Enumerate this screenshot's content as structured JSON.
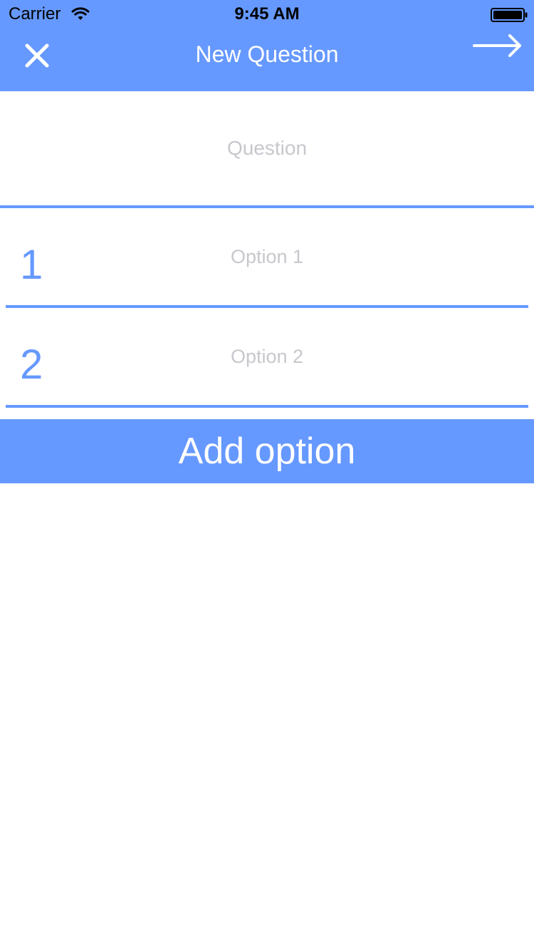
{
  "status_bar": {
    "carrier": "Carrier",
    "time": "9:45 AM",
    "icons": [
      "wifi-icon",
      "battery-icon"
    ]
  },
  "nav": {
    "title": "New Question",
    "close_icon": "close-icon",
    "next_icon": "arrow-right-icon"
  },
  "question": {
    "placeholder": "Question",
    "value": ""
  },
  "options": [
    {
      "number": "1",
      "placeholder": "Option 1",
      "value": ""
    },
    {
      "number": "2",
      "placeholder": "Option 2",
      "value": ""
    }
  ],
  "add_option_label": "Add option",
  "colors": {
    "accent": "#6699ff",
    "placeholder": "#c7c7cd",
    "background": "#ffffff"
  }
}
